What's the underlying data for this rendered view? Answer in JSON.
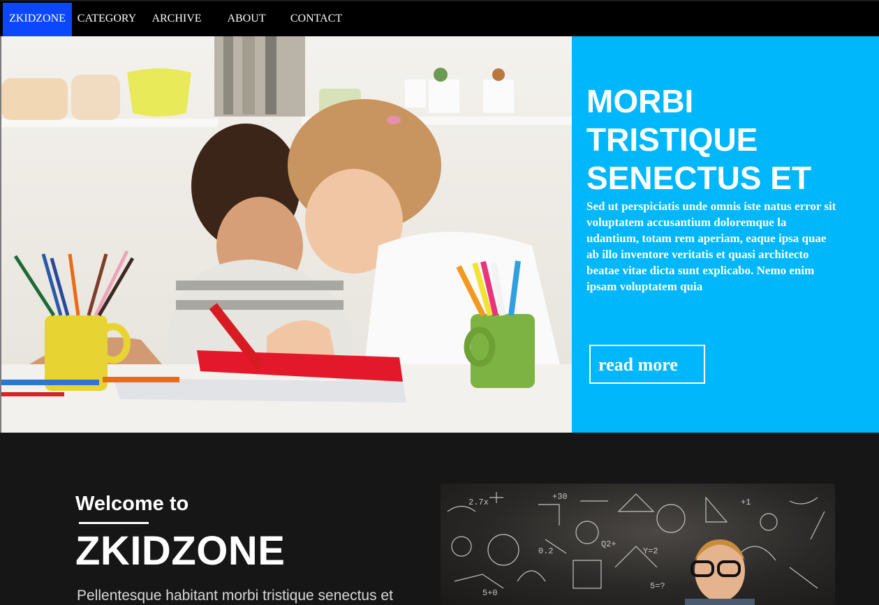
{
  "nav": {
    "items": [
      {
        "label": "ZKIDZONE",
        "active": true
      },
      {
        "label": "CATEGORY",
        "active": false
      },
      {
        "label": "ARCHIVE",
        "active": false
      },
      {
        "label": "ABOUT",
        "active": false
      },
      {
        "label": "CONTACT",
        "active": false
      }
    ]
  },
  "hero": {
    "image_alt": "two-girls-drawing-photo",
    "title": "MORBI TRISTIQUE SENECTUS ET",
    "text": "Sed ut perspiciatis unde omnis iste natus error sit voluptatem accusantium doloremque la udantium, totam rem aperiam, eaque ipsa quae ab illo inventore veritatis et quasi architecto beatae vitae dicta sunt explicabo. Nemo enim ipsam voluptatem quia",
    "button_label": "read more"
  },
  "welcome": {
    "subtitle": "Welcome to",
    "title": "ZKIDZONE",
    "text": "Pellentesque habitant morbi tristique senectus et"
  },
  "colors": {
    "nav_bg": "#000000",
    "nav_active": "#0a47ff",
    "hero_panel": "#00b7fb",
    "section_bg": "#161616"
  }
}
